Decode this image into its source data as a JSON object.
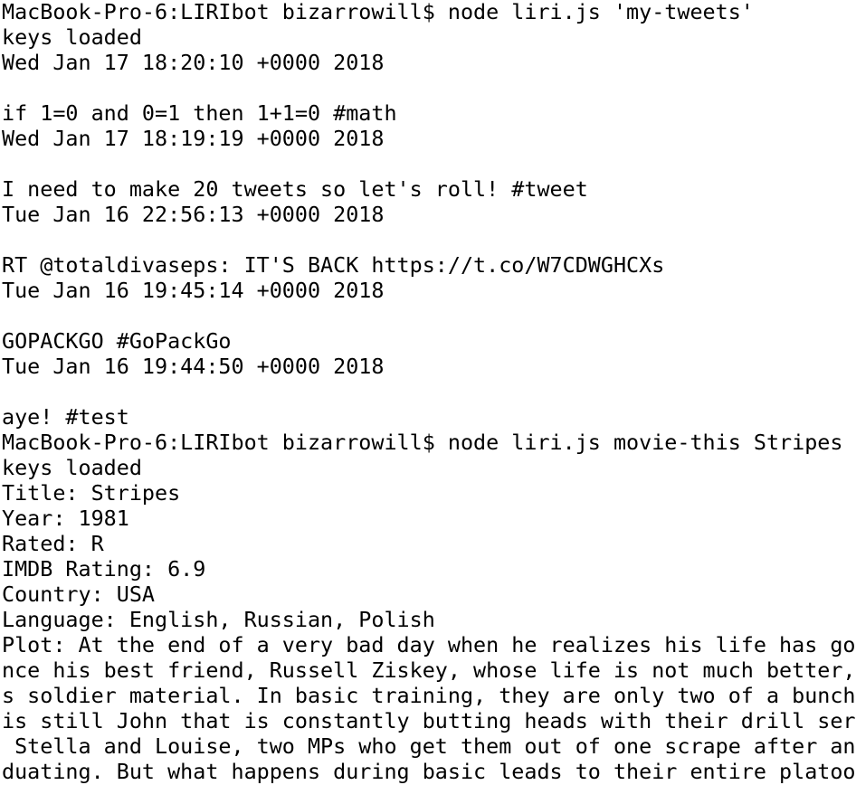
{
  "terminal": {
    "lines": [
      "MacBook-Pro-6:LIRIbot bizarrowill$ node liri.js 'my-tweets'",
      "keys loaded",
      "Wed Jan 17 18:20:10 +0000 2018",
      "",
      "if 1=0 and 0=1 then 1+1=0 #math",
      "Wed Jan 17 18:19:19 +0000 2018",
      "",
      "I need to make 20 tweets so let's roll! #tweet",
      "Tue Jan 16 22:56:13 +0000 2018",
      "",
      "RT @totaldivaseps: IT'S BACK https://t.co/W7CDWGHCXs",
      "Tue Jan 16 19:45:14 +0000 2018",
      "",
      "GOPACKGO #GoPackGo",
      "Tue Jan 16 19:44:50 +0000 2018",
      "",
      "aye! #test",
      "MacBook-Pro-6:LIRIbot bizarrowill$ node liri.js movie-this Stripes",
      "keys loaded",
      "Title: Stripes",
      "Year: 1981",
      "Rated: R",
      "IMDB Rating: 6.9",
      "Country: USA",
      "Language: English, Russian, Polish",
      "Plot: At the end of a very bad day when he realizes his life has gon",
      "nce his best friend, Russell Ziskey, whose life is not much better,",
      "s soldier material. In basic training, they are only two of a bunch",
      "is still John that is constantly butting heads with their drill serg",
      " Stella and Louise, two MPs who get them out of one scrape after and",
      "duating. But what happens during basic leads to their entire platoon"
    ]
  }
}
